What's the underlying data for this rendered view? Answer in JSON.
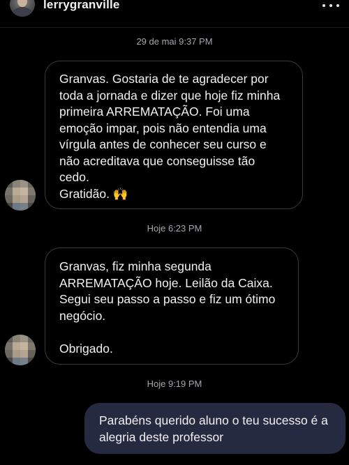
{
  "header": {
    "username": "lerrygranville",
    "avatar_icon": "profile-avatar",
    "more_icon": "more-dots-icon"
  },
  "conversation": [
    {
      "timestamp": "29 de mai 9:37 PM",
      "sender": "contact",
      "text": "Granvas. Gostaria de te agradecer por\ntoda a jornada e dizer que hoje fiz minha\nprimeira ARREMATAÇÃO. Foi uma\nemoção impar, pois não entendia uma\nvírgula antes de conhecer seu curso e\nnão acreditava que conseguisse tão\ncedo.\nGratidão.",
      "emoji": "🙌"
    },
    {
      "timestamp": "Hoje 6:23 PM",
      "sender": "contact",
      "text": "Granvas, fiz minha segunda\nARREMATAÇÃO hoje. Leilão da Caixa.\nSegui seu passo a passo e fiz um ótimo\nnegócio.\n\nObrigado."
    },
    {
      "timestamp": "Hoje 9:19 PM",
      "sender": "me",
      "text": "Parabéns querido aluno o teu sucesso é a\nalegria deste professor"
    }
  ],
  "colors": {
    "background": "#000000",
    "incoming_border": "#3a3a3e",
    "outgoing_bubble": "#252a40",
    "timestamp_text": "#a6a6ad"
  }
}
